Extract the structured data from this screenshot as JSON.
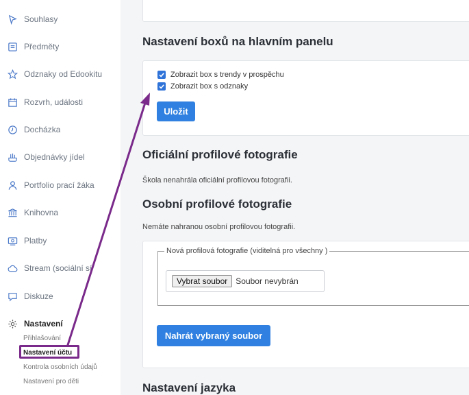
{
  "sidebar": {
    "items": [
      {
        "label": "Souhlasy",
        "icon": "cursor-icon"
      },
      {
        "label": "Předměty",
        "icon": "book-icon"
      },
      {
        "label": "Odznaky od Edookitu",
        "icon": "star-icon"
      },
      {
        "label": "Rozvrh, události",
        "icon": "calendar-icon"
      },
      {
        "label": "Docházka",
        "icon": "clock-icon"
      },
      {
        "label": "Objednávky jídel",
        "icon": "food-icon"
      },
      {
        "label": "Portfolio prací žáka",
        "icon": "user-icon"
      },
      {
        "label": "Knihovna",
        "icon": "library-icon"
      },
      {
        "label": "Platby",
        "icon": "wallet-icon"
      },
      {
        "label": "Stream (sociální sí",
        "icon": "cloud-icon"
      },
      {
        "label": "Diskuze",
        "icon": "chat-icon"
      },
      {
        "label": "Nastavení",
        "icon": "gear-icon"
      }
    ],
    "subitems": [
      "Přihlašování",
      "Nastavení účtu",
      "Kontrola osobních údajů",
      "Nastavení pro děti"
    ]
  },
  "main": {
    "dashboard_title": "Nastavení boxů na hlavním panelu",
    "checkbox_trends": "Zobrazit box s trendy v prospěchu",
    "checkbox_badges": "Zobrazit box s odznaky",
    "save_label": "Uložit",
    "official_title": "Oficiální profilové fotografie",
    "official_text": "Škola nenahrála oficiální profilovou fotografii.",
    "personal_title": "Osobní profilové fotografie",
    "personal_text": "Nemáte nahranou osobní profilovou fotografii.",
    "fieldset_legend": "Nová profilová fotografie (viditelná pro všechny )",
    "file_button": "Vybrat soubor",
    "file_status": "Soubor nevybrán",
    "upload_label": "Nahrát vybraný soubor",
    "language_title": "Nastavení jazyka"
  },
  "colors": {
    "accent": "#2f80e0",
    "annotation": "#7a2a8a"
  }
}
